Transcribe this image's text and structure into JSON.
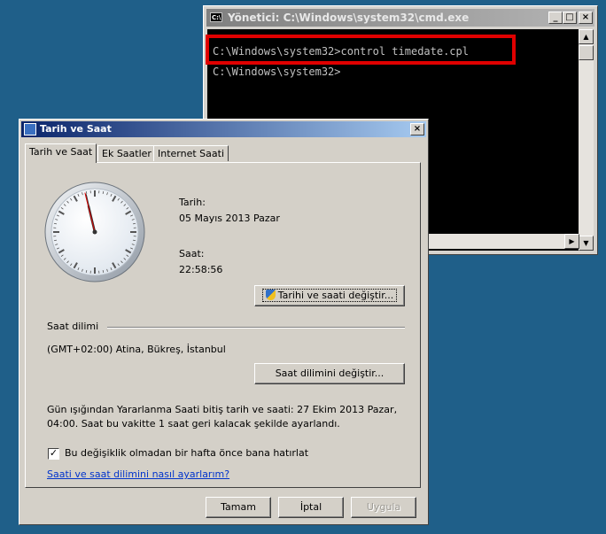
{
  "cmd": {
    "title": "Yönetici: C:\\Windows\\system32\\cmd.exe",
    "line1": "C:\\Windows\\system32>control timedate.cpl",
    "line2": "C:\\Windows\\system32>",
    "minimize": "_",
    "maximize": "□",
    "close": "×"
  },
  "dialog": {
    "title": "Tarih ve Saat",
    "close": "×",
    "tabs": [
      "Tarih ve Saat",
      "Ek Saatler",
      "Internet Saati"
    ],
    "date_label": "Tarih:",
    "date_value": "05 Mayıs 2013 Pazar",
    "time_label": "Saat:",
    "time_value": "22:58:56",
    "change_datetime_button": "Tarihi ve saati değiştir...",
    "timezone_group": "Saat dilimi",
    "timezone_value": "(GMT+02:00) Atina, Bükreş, İstanbul",
    "change_timezone_button": "Saat dilimini değiştir...",
    "dst_line1": "Gün ışığından Yararlanma Saati bitiş tarih ve saati: 27 Ekim 2013 Pazar,",
    "dst_line2": "04:00. Saat bu vakitte 1 saat geri kalacak şekilde ayarlandı.",
    "notify_checkbox_label": "Bu değişiklik olmadan bir hafta önce bana hatırlat",
    "notify_checked": true,
    "help_link": "Saati ve saat dilimini nasıl ayarlarım?",
    "ok_button": "Tamam",
    "cancel_button": "İptal",
    "apply_button": "Uygula"
  },
  "icons": {
    "cmd": "console-icon",
    "dialog": "date-time-icon",
    "shield": "uac-shield-icon",
    "clock": "analog-clock-icon"
  },
  "colors": {
    "desktop": "#1f5f89",
    "highlight": "#e00000",
    "link": "#0033cc"
  }
}
